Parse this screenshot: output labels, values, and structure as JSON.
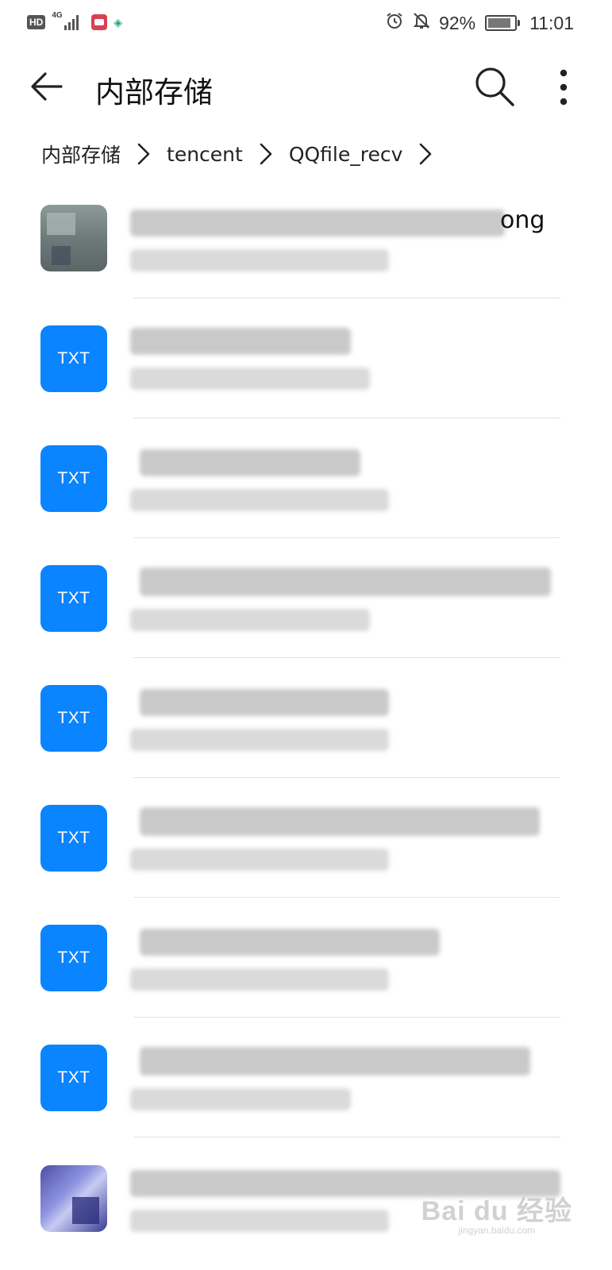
{
  "status_bar": {
    "hd": "HD",
    "network": "4G",
    "battery": "92%",
    "time": "11:01",
    "icons": [
      "alarm-icon",
      "mute-bell-icon",
      "battery-icon"
    ]
  },
  "header": {
    "title": "内部存储",
    "icons": [
      "back-arrow-icon",
      "search-icon",
      "more-vertical-icon"
    ]
  },
  "breadcrumb": {
    "items": [
      "内部存储",
      "tencent",
      "QQfile_recv"
    ]
  },
  "files": [
    {
      "type": "image",
      "name_tail": "ong"
    },
    {
      "type": "txt",
      "badge": "TXT"
    },
    {
      "type": "txt",
      "badge": "TXT"
    },
    {
      "type": "txt",
      "badge": "TXT"
    },
    {
      "type": "txt",
      "badge": "TXT"
    },
    {
      "type": "txt",
      "badge": "TXT"
    },
    {
      "type": "txt",
      "badge": "TXT"
    },
    {
      "type": "txt",
      "badge": "TXT"
    },
    {
      "type": "image"
    }
  ],
  "watermark": {
    "main": "Bai du 经验",
    "sub": "jingyan.baidu.com"
  },
  "colors": {
    "accent": "#0a84ff",
    "divider": "#e3e3e3"
  }
}
